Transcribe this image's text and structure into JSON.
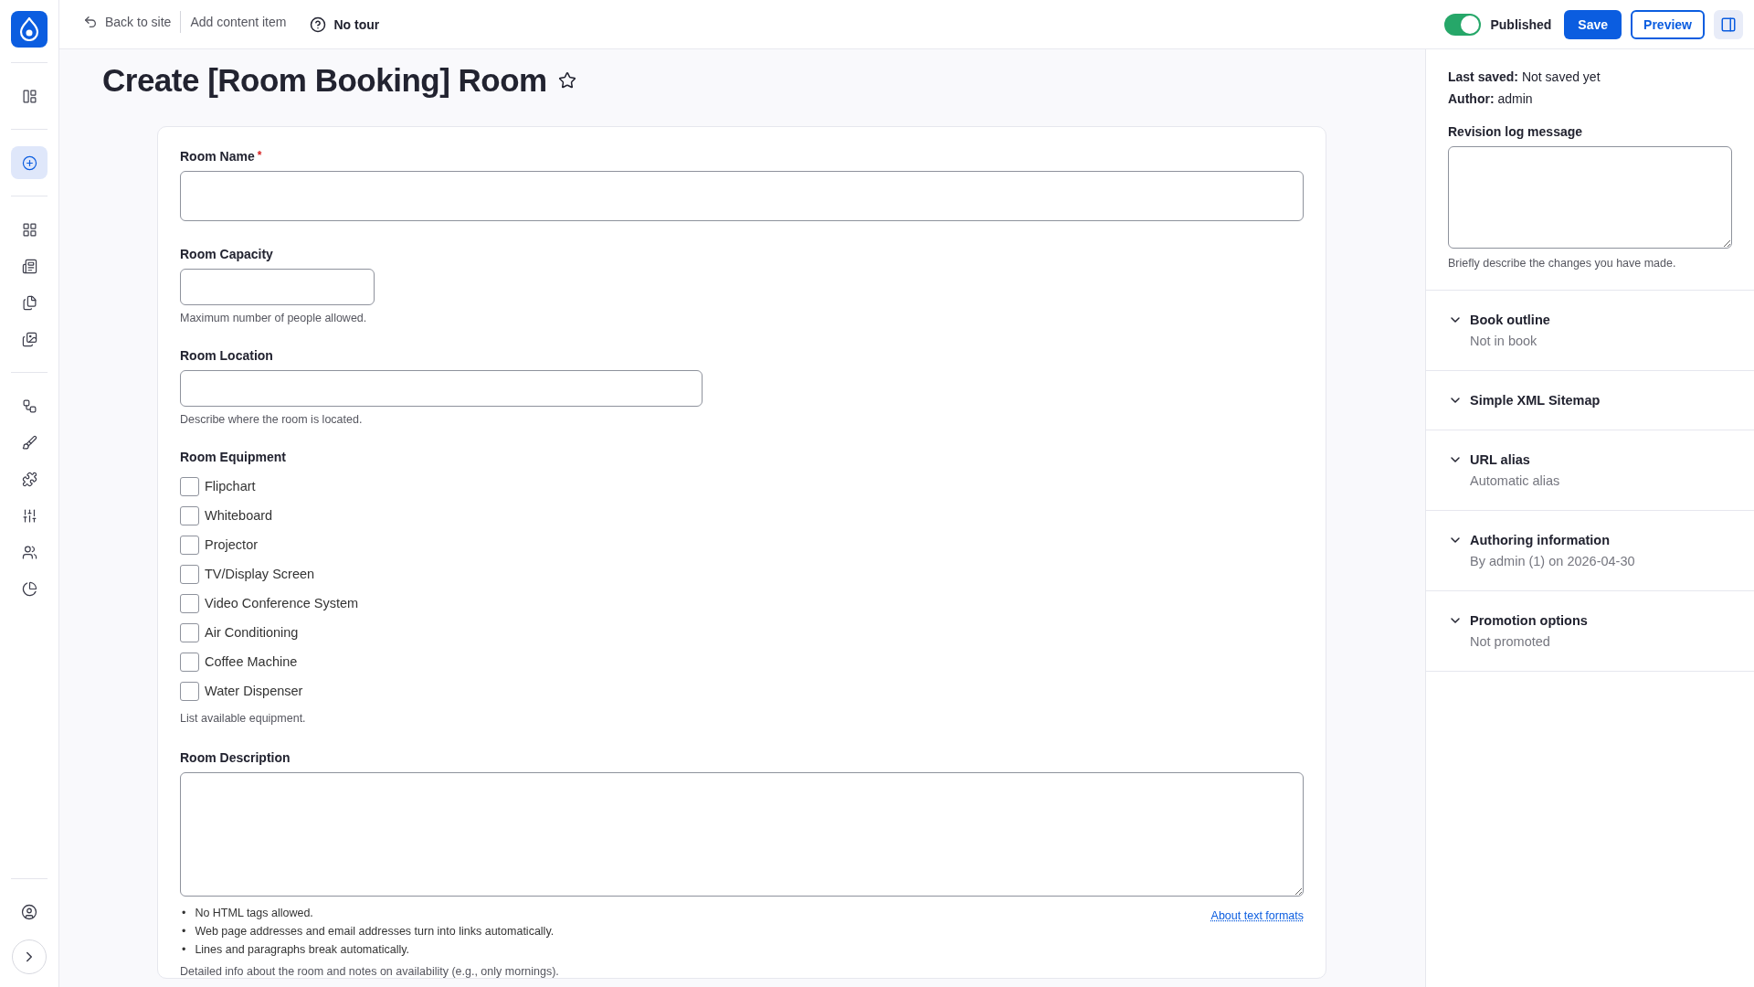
{
  "sidebar": {
    "items": [
      {
        "selected": false
      },
      {
        "selected": true
      },
      {
        "selected": false
      },
      {
        "selected": false
      },
      {
        "selected": false
      },
      {
        "selected": false
      },
      {
        "selected": false
      },
      {
        "selected": false
      },
      {
        "selected": false
      },
      {
        "selected": false
      },
      {
        "selected": false
      },
      {
        "selected": false
      }
    ]
  },
  "toolbar": {
    "back_link": "Back to site",
    "breadcrumb": "Add content item",
    "tour": "No tour",
    "published": {
      "label": "Published",
      "on": true
    },
    "save": "Save",
    "preview": "Preview"
  },
  "title": "Create [Room Booking] Room",
  "fields": [
    {
      "kind": "text",
      "label": "Room Name",
      "required_mark": "*"
    },
    {
      "kind": "text",
      "label": "Room Capacity",
      "description": "Maximum number of people allowed."
    },
    {
      "kind": "text",
      "label": "Room Location",
      "description": "Describe where the room is located."
    },
    {
      "kind": "checkboxes",
      "label": "Room Equipment",
      "options": [
        {
          "label": "Flipchart",
          "checked": false
        },
        {
          "label": "Whiteboard",
          "checked": false
        },
        {
          "label": "Projector",
          "checked": false
        },
        {
          "label": "TV/Display Screen",
          "checked": false
        },
        {
          "label": "Video Conference System",
          "checked": false
        },
        {
          "label": "Air Conditioning",
          "checked": false
        },
        {
          "label": "Coffee Machine",
          "checked": false
        },
        {
          "label": "Water Dispenser",
          "checked": false
        }
      ],
      "description": "List available equipment."
    },
    {
      "kind": "textarea",
      "label": "Room Description",
      "tips": [
        {
          "bullet": "•",
          "text": "No HTML tags allowed."
        },
        {
          "bullet": "•",
          "text": "Web page addresses and email addresses turn into links automatically."
        },
        {
          "bullet": "•",
          "text": "Lines and paragraphs break automatically."
        }
      ],
      "link": "About text formats",
      "description": "Detailed info about the room and notes on availability (e.g., only mornings)."
    }
  ],
  "meta": {
    "last_saved": {
      "label": "Last saved:",
      "value": "Not saved yet"
    },
    "author": {
      "label": "Author:",
      "value": "admin"
    },
    "revision_log": {
      "label": "Revision log message",
      "description": "Briefly describe the changes you have made."
    },
    "sections": [
      {
        "title": "Book outline",
        "summary": "Not in book"
      },
      {
        "title": "Simple XML Sitemap"
      },
      {
        "title": "URL alias",
        "summary": "Automatic alias"
      },
      {
        "title": "Authoring information",
        "summary": "By admin (1) on 2026-04-30"
      },
      {
        "title": "Promotion options",
        "summary": "Not promoted"
      }
    ]
  }
}
